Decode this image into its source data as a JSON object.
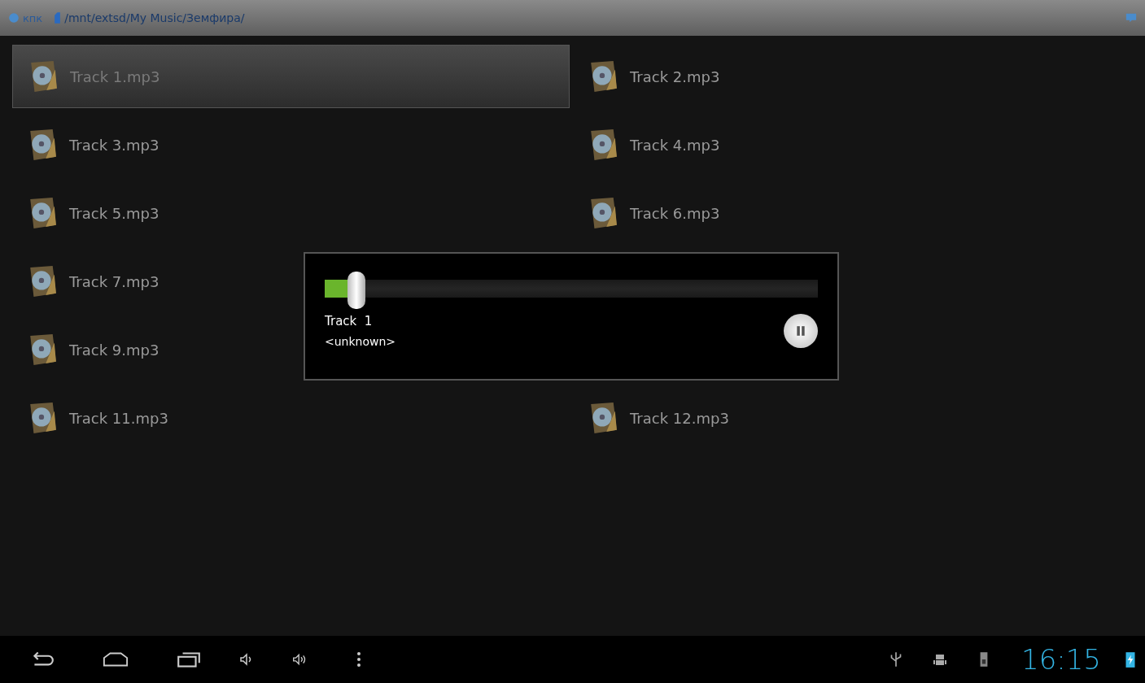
{
  "title_bar": {
    "app_label": "кпк",
    "path": "/mnt/extsd/My Music/Земфира/"
  },
  "files": [
    {
      "kind": "file",
      "name": "Track 1.mp3",
      "selected": true
    },
    {
      "kind": "file",
      "name": "Track 2.mp3",
      "selected": false
    },
    {
      "kind": "file",
      "name": "Track 3.mp3",
      "selected": false
    },
    {
      "kind": "file",
      "name": "Track 4.mp3",
      "selected": false
    },
    {
      "kind": "file",
      "name": "Track 5.mp3",
      "selected": false
    },
    {
      "kind": "file",
      "name": "Track 6.mp3",
      "selected": false
    },
    {
      "kind": "file",
      "name": "Track 7.mp3",
      "selected": false
    },
    {
      "kind": "covered"
    },
    {
      "kind": "file",
      "name": "Track 9.mp3",
      "selected": false
    },
    {
      "kind": "covered"
    },
    {
      "kind": "file",
      "name": "Track 11.mp3",
      "selected": false
    },
    {
      "kind": "file",
      "name": "Track 12.mp3",
      "selected": false
    }
  ],
  "player": {
    "level": 0.05,
    "title": "Track  1",
    "artist": "<unknown>",
    "playing": true
  },
  "status_bar": {
    "time": "16:15"
  }
}
